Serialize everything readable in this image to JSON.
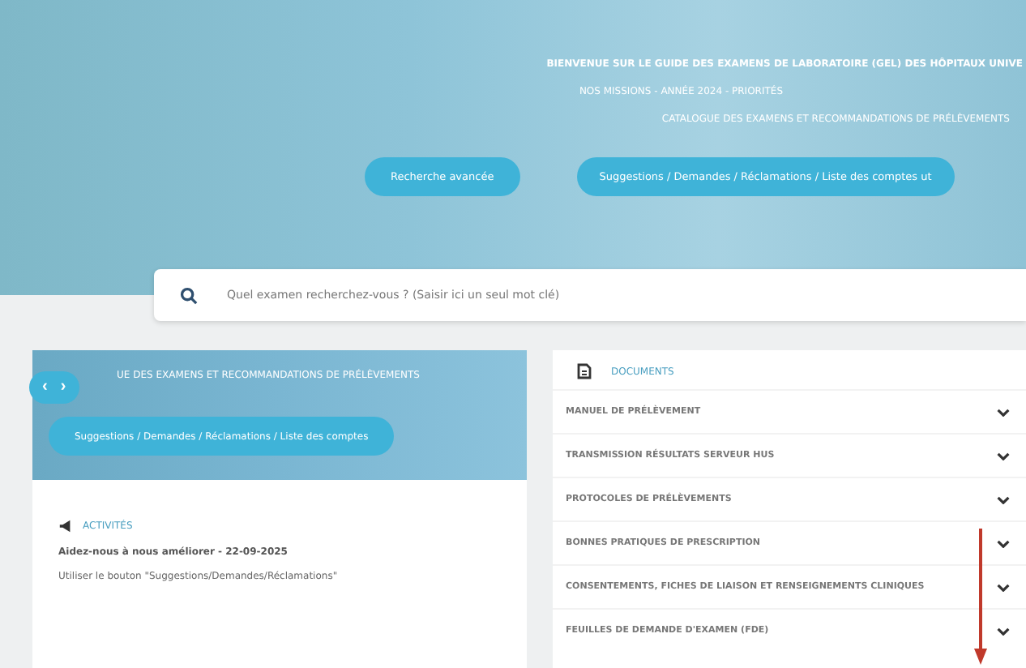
{
  "hero": {
    "title": "BIENVENUE SUR LE GUIDE DES EXAMENS DE LABORATOIRE (GEL) DES HÔPITAUX UNIVE",
    "subtitle": "NOS MISSIONS - ANNÉE 2024 - PRIORITÉS",
    "tagline": "CATALOGUE DES EXAMENS ET RECOMMANDATIONS DE PRÉLÈVEMENTS",
    "buttons": [
      "Recherche avancée",
      "Suggestions / Demandes / Réclamations / Liste des comptes ut"
    ]
  },
  "search": {
    "placeholder": "Quel examen recherchez-vous ? (Saisir ici un seul mot clé)"
  },
  "slider": {
    "prev": "‹",
    "next": "›",
    "title": "UE DES EXAMENS ET RECOMMANDATIONS DE PRÉLÈVEMENTS",
    "button": "Suggestions / Demandes / Réclamations / Liste des comptes"
  },
  "activities": {
    "title": "ACTIVITÉS",
    "lines": [
      "Aidez-nous à nous améliorer - 22-09-2025",
      "Utiliser le bouton \"Suggestions/Demandes/Réclamations\""
    ]
  },
  "documents": {
    "title": "DOCUMENTS",
    "items": [
      {
        "label": "MANUEL DE PRÉLÈVEMENT",
        "expanded": false
      },
      {
        "label": "TRANSMISSION RÉSULTATS SERVEUR HUS",
        "expanded": false
      },
      {
        "label": "PROTOCOLES DE PRÉLÈVEMENTS",
        "expanded": false
      },
      {
        "label": "BONNES PRATIQUES DE PRESCRIPTION",
        "expanded": false
      },
      {
        "label": "CONSENTEMENTS, FICHES DE LIAISON ET RENSEIGNEMENTS CLINIQUES",
        "expanded": false
      },
      {
        "label": "FEUILLES DE DEMANDE D'EXAMEN (FDE)",
        "expanded": false
      }
    ]
  }
}
